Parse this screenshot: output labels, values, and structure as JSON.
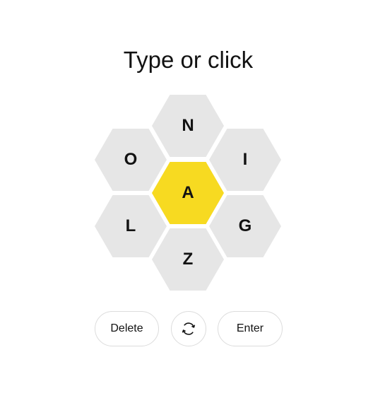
{
  "header": {
    "prompt": "Type or click"
  },
  "colors": {
    "center": "#f7da21",
    "outer": "#e6e6e6"
  },
  "hive": {
    "center_letter": "A",
    "outer_letters": {
      "top": "N",
      "upper_left": "O",
      "upper_right": "I",
      "lower_left": "L",
      "lower_right": "G",
      "bottom": "Z"
    }
  },
  "controls": {
    "delete_label": "Delete",
    "shuffle_icon": "shuffle-icon",
    "enter_label": "Enter"
  }
}
